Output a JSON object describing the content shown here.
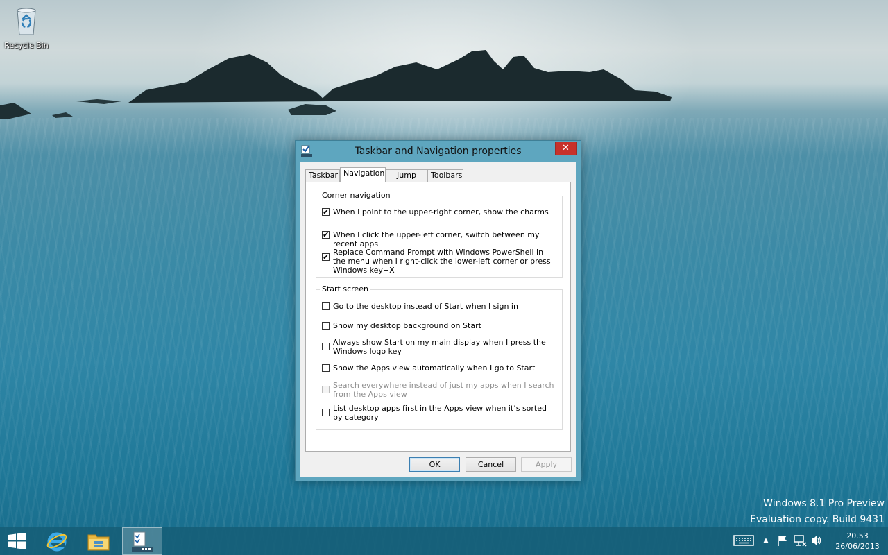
{
  "desktop": {
    "recycle_bin_label": "Recycle Bin",
    "watermark_line1": "Windows 8.1 Pro Preview",
    "watermark_line2": "Evaluation copy. Build 9431"
  },
  "dialog": {
    "title": "Taskbar and Navigation properties",
    "close_symbol": "✕",
    "tabs": [
      {
        "label": "Taskbar",
        "active": false
      },
      {
        "label": "Navigation",
        "active": true
      },
      {
        "label": "Jump Lists",
        "active": false
      },
      {
        "label": "Toolbars",
        "active": false
      }
    ],
    "corner_navigation": {
      "title": "Corner navigation",
      "options": [
        {
          "label": "When I point to the upper-right corner, show the charms",
          "checked": true,
          "enabled": true
        },
        {
          "label": "When I click the upper-left corner, switch between my recent apps",
          "checked": true,
          "enabled": true
        },
        {
          "label": "Replace Command Prompt with Windows PowerShell in the menu when I right-click the lower-left corner or press Windows key+X",
          "checked": true,
          "enabled": true
        }
      ]
    },
    "start_screen": {
      "title": "Start screen",
      "options": [
        {
          "label": "Go to the desktop instead of Start when I sign in",
          "checked": false,
          "enabled": true
        },
        {
          "label": "Show my desktop background on Start",
          "checked": false,
          "enabled": true
        },
        {
          "label": "Always show Start on my main display when I press the Windows logo key",
          "checked": false,
          "enabled": true
        },
        {
          "label": "Show the Apps view automatically when I go to Start",
          "checked": false,
          "enabled": true
        },
        {
          "label": "Search everywhere instead of just my apps when I search from the Apps view",
          "checked": false,
          "enabled": false
        },
        {
          "label": "List desktop apps first in the Apps view when it’s sorted by category",
          "checked": false,
          "enabled": true
        }
      ]
    },
    "buttons": {
      "ok": "OK",
      "cancel": "Cancel",
      "apply": "Apply"
    }
  },
  "taskbar": {
    "pinned": [
      "start-button",
      "internet-explorer-icon",
      "file-explorer-icon",
      "taskbar-properties-icon"
    ],
    "tray": {
      "show_hidden_symbol": "▲",
      "time": "20.53",
      "date": "26/06/2013"
    }
  },
  "colors": {
    "dialog_frame": "#5ea6bf",
    "close_button": "#c7312a",
    "taskbar": "#165f78"
  }
}
